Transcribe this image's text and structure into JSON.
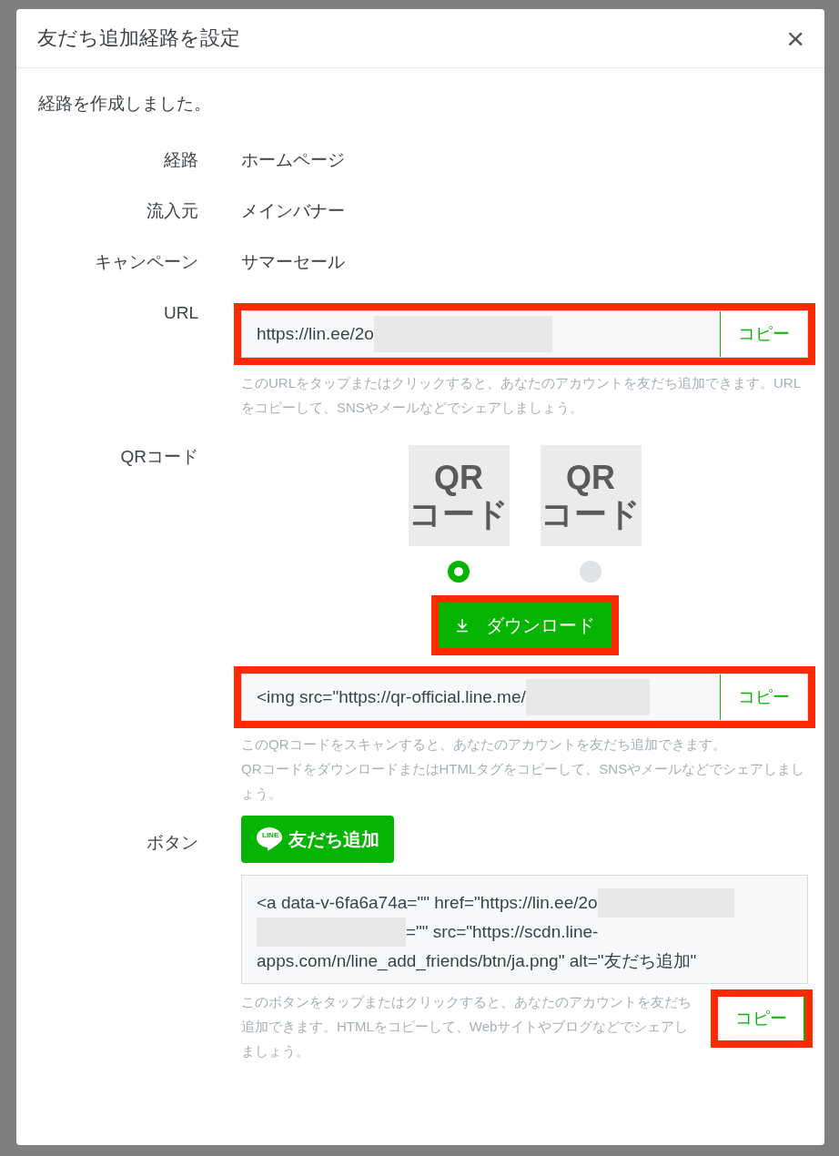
{
  "dialog": {
    "title": "友だち追加経路を設定",
    "close_label": "×"
  },
  "message": "経路を作成しました。",
  "details": [
    {
      "label": "経路",
      "value": "ホームページ"
    },
    {
      "label": "流入元",
      "value": "メインバナー"
    },
    {
      "label": "キャンペーン",
      "value": "サマーセール"
    }
  ],
  "url_section": {
    "label": "URL",
    "field": {
      "value": "https://lin.ee/2o",
      "redacted": true,
      "highlighted": true,
      "copy_label": "コピー"
    },
    "help": "このURLをタップまたはクリックすると、あなたのアカウントを友だち追加できます。URLをコピーして、SNSやメールなどでシェアしましょう。"
  },
  "qr_section": {
    "label": "QRコード",
    "options": [
      {
        "line1": "QR",
        "line2": "コード",
        "selected": true
      },
      {
        "line1": "QR",
        "line2": "コード",
        "selected": false
      }
    ],
    "download": {
      "label": "ダウンロード",
      "highlighted": true
    },
    "field": {
      "value": "<img src=\"https://qr-official.line.me/",
      "redacted": true,
      "highlighted": true,
      "copy_label": "コピー"
    },
    "help": [
      "このQRコードをスキャンすると、あなたのアカウントを友だち追加できます。",
      "QRコードをダウンロードまたはHTMLタグをコピーして、SNSやメールなどでシェアしましょう。"
    ]
  },
  "button_section": {
    "label": "ボタン",
    "add_friend_button": {
      "badge": "LINE",
      "label": "友だち追加"
    },
    "html_code": [
      [
        {
          "kind": "text",
          "text": "<a data-v-6fa6a74a=\"\" href=\"https://lin.ee/2o"
        },
        {
          "kind": "redacted"
        }
      ],
      [
        {
          "kind": "redacted"
        },
        {
          "kind": "text",
          "text": "=\"\" src=\"https://scdn.line-"
        }
      ],
      [
        {
          "kind": "text",
          "text": "apps.com/n/line_add_friends/btn/ja.png\" alt=\"友だち追加\""
        }
      ]
    ],
    "help": "このボタンをタップまたはクリックすると、あなたのアカウントを友だち追加できます。HTMLをコピーして、Webサイトやブログなどでシェアしましょう。",
    "copy": {
      "label": "コピー",
      "highlighted": true
    }
  }
}
